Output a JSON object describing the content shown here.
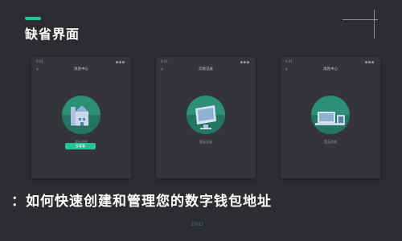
{
  "header": {
    "title": "缺省界面"
  },
  "screens": [
    {
      "status_time": "9:41",
      "nav_title": "消息中心",
      "illustration": "building-icon",
      "caption": "暂无消息",
      "button_label": "去看看"
    },
    {
      "status_time": "9:41",
      "nav_title": "交易记录",
      "illustration": "monitor-icon",
      "caption": "暂无记录"
    },
    {
      "status_time": "9:41",
      "nav_title": "消息中心",
      "illustration": "devices-icon",
      "caption": "暂无消息"
    }
  ],
  "footer": {
    "title": "：如何快速创建和管理您的数字钱包地址",
    "watermark": "END"
  },
  "colors": {
    "background": "#2b2d30",
    "card": "#333539",
    "accent": "#24c39a"
  }
}
